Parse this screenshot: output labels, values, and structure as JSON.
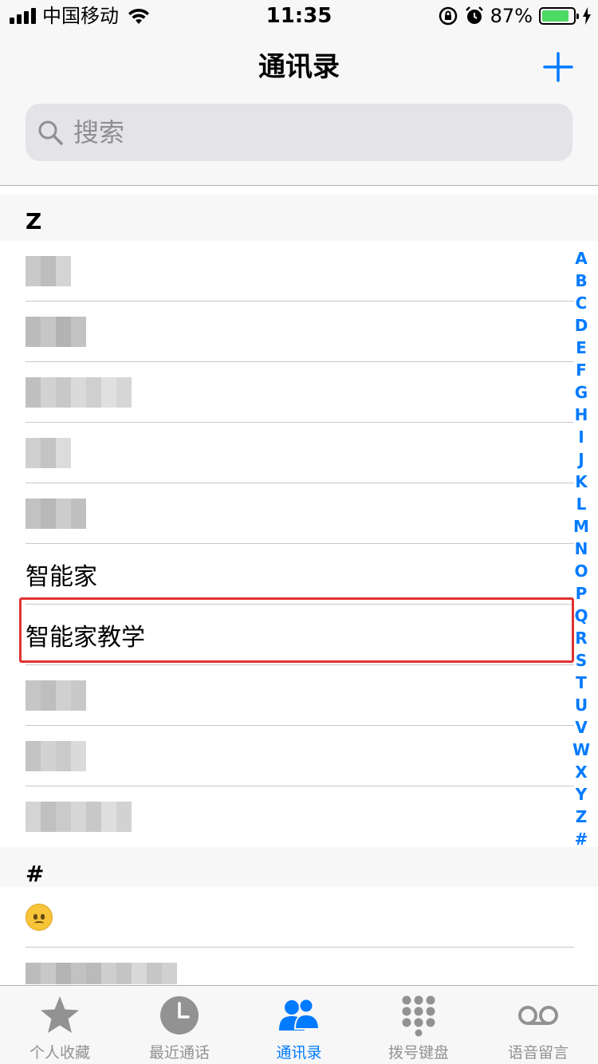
{
  "status_bar": {
    "carrier": "中国移动",
    "time": "11:35",
    "battery_percent": "87%",
    "battery_level": 0.87,
    "icons": [
      "signal-icon",
      "wifi-icon",
      "rotation-lock-icon",
      "alarm-icon",
      "battery-icon",
      "charging-icon"
    ]
  },
  "header": {
    "title": "通讯录",
    "add_icon": "plus-icon"
  },
  "search": {
    "placeholder": "搜索",
    "value": "",
    "icon": "search-icon"
  },
  "contacts": {
    "sections": [
      {
        "letter": "Z",
        "rows": [
          {
            "name": "",
            "obscured": true
          },
          {
            "name": "",
            "obscured": true
          },
          {
            "name": "",
            "obscured": true
          },
          {
            "name": "",
            "obscured": true
          },
          {
            "name": "",
            "obscured": true
          },
          {
            "name": "智能家",
            "obscured": false
          },
          {
            "name": "智能家教学",
            "obscured": false,
            "highlighted": true
          },
          {
            "name": "",
            "obscured": true
          },
          {
            "name": "",
            "obscured": true
          },
          {
            "name": "",
            "obscured": true
          }
        ]
      },
      {
        "letter": "#",
        "rows": [
          {
            "name": "",
            "emoji": "upside-down-face-emoji"
          },
          {
            "name": "",
            "obscured": true
          }
        ]
      }
    ]
  },
  "index_letters": [
    "A",
    "B",
    "C",
    "D",
    "E",
    "F",
    "G",
    "H",
    "I",
    "J",
    "K",
    "L",
    "M",
    "N",
    "O",
    "P",
    "Q",
    "R",
    "S",
    "T",
    "U",
    "V",
    "W",
    "X",
    "Y",
    "Z",
    "#"
  ],
  "tab_bar": {
    "active": "contacts",
    "tabs": [
      {
        "id": "favorites",
        "label": "个人收藏",
        "icon": "star-icon"
      },
      {
        "id": "recents",
        "label": "最近通话",
        "icon": "clock-icon"
      },
      {
        "id": "contacts",
        "label": "通讯录",
        "icon": "contacts-icon"
      },
      {
        "id": "keypad",
        "label": "拨号键盘",
        "icon": "keypad-icon"
      },
      {
        "id": "voicemail",
        "label": "语音留言",
        "icon": "voicemail-icon"
      }
    ]
  },
  "colors": {
    "accent": "#007aff",
    "highlight_border": "#e03232",
    "battery_fill": "#4cd964",
    "inactive_tab": "#929292"
  }
}
